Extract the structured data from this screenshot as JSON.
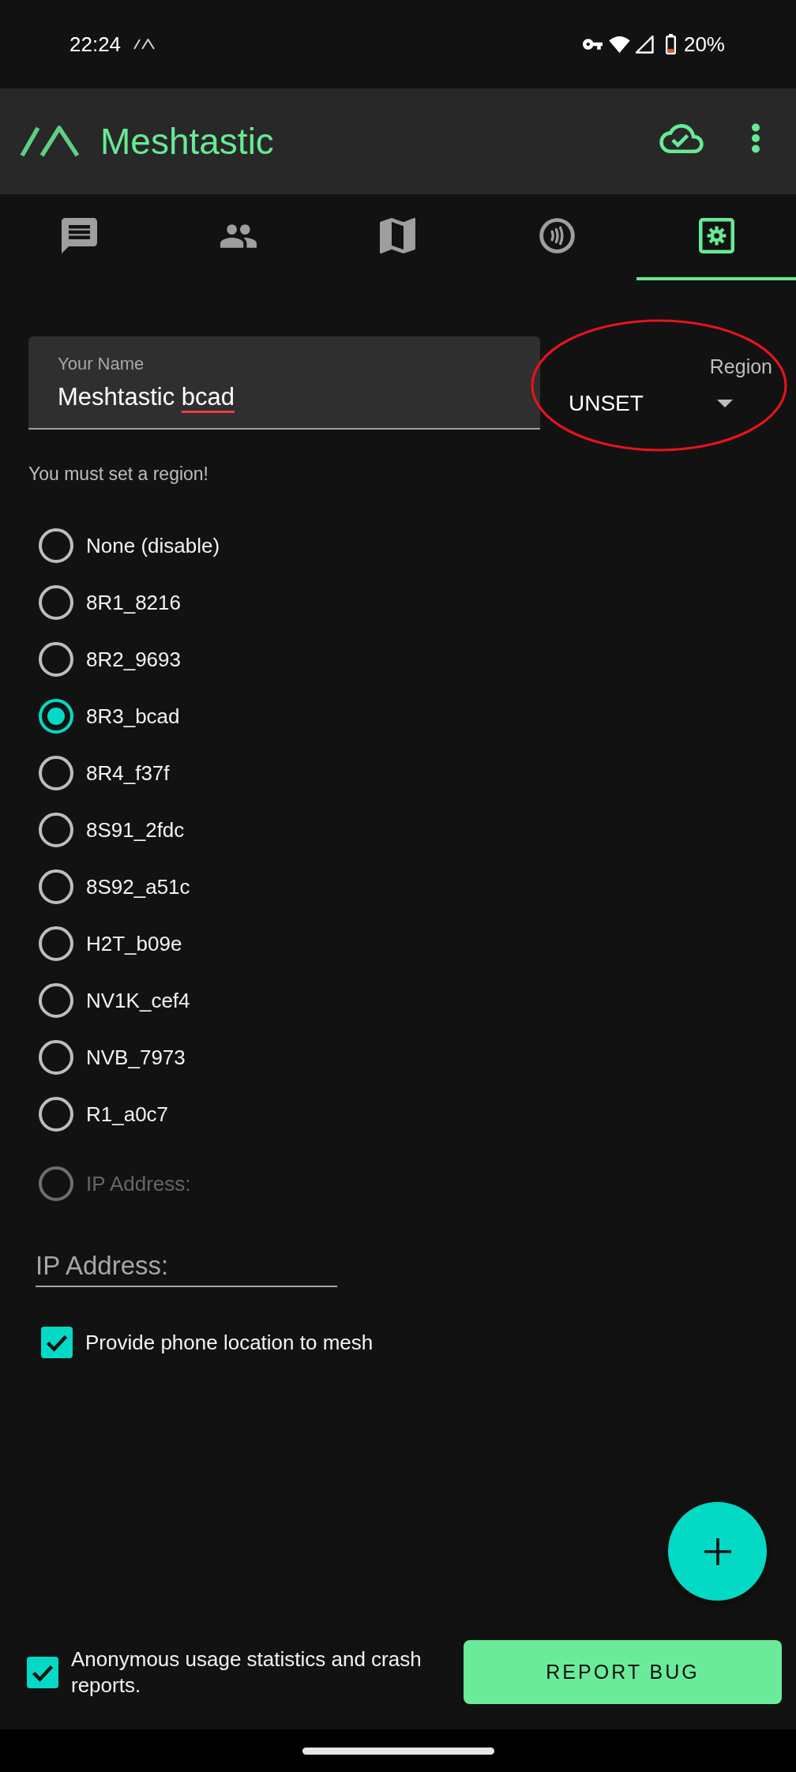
{
  "status_bar": {
    "time": "22:24",
    "battery_percent": "20%"
  },
  "app_bar": {
    "title": "Meshtastic"
  },
  "tabs": [
    {
      "kind": "messages",
      "selected": false
    },
    {
      "kind": "nodes",
      "selected": false
    },
    {
      "kind": "map",
      "selected": false
    },
    {
      "kind": "channel",
      "selected": false
    },
    {
      "kind": "settings",
      "selected": true
    }
  ],
  "name_field": {
    "label": "Your Name",
    "value_words": [
      {
        "text": "Meshtastic",
        "misspelled": false
      },
      {
        "text": "bcad",
        "misspelled": true
      }
    ]
  },
  "region": {
    "label": "Region",
    "value": "UNSET",
    "annotation": {
      "kind": "ellipse"
    }
  },
  "region_warning": "You must set a region!",
  "devices": [
    {
      "label": "None (disable)",
      "selected": false,
      "disabled": false
    },
    {
      "label": "8R1_8216",
      "selected": false,
      "disabled": false
    },
    {
      "label": "8R2_9693",
      "selected": false,
      "disabled": false
    },
    {
      "label": "8R3_bcad",
      "selected": true,
      "disabled": false
    },
    {
      "label": "8R4_f37f",
      "selected": false,
      "disabled": false
    },
    {
      "label": "8S91_2fdc",
      "selected": false,
      "disabled": false
    },
    {
      "label": "8S92_a51c",
      "selected": false,
      "disabled": false
    },
    {
      "label": "H2T_b09e",
      "selected": false,
      "disabled": false
    },
    {
      "label": "NV1K_cef4",
      "selected": false,
      "disabled": false
    },
    {
      "label": "NVB_7973",
      "selected": false,
      "disabled": false
    },
    {
      "label": "R1_a0c7",
      "selected": false,
      "disabled": false
    },
    {
      "label": "IP Address:",
      "selected": false,
      "disabled": true
    }
  ],
  "ip_field": {
    "placeholder": "IP Address:"
  },
  "location_option": {
    "label": "Provide phone location to mesh",
    "checked": true
  },
  "footer": {
    "analytics_option": {
      "label": "Anonymous usage statistics and crash reports.",
      "checked": true
    },
    "report_button": {
      "label": "REPORT BUG"
    }
  }
}
